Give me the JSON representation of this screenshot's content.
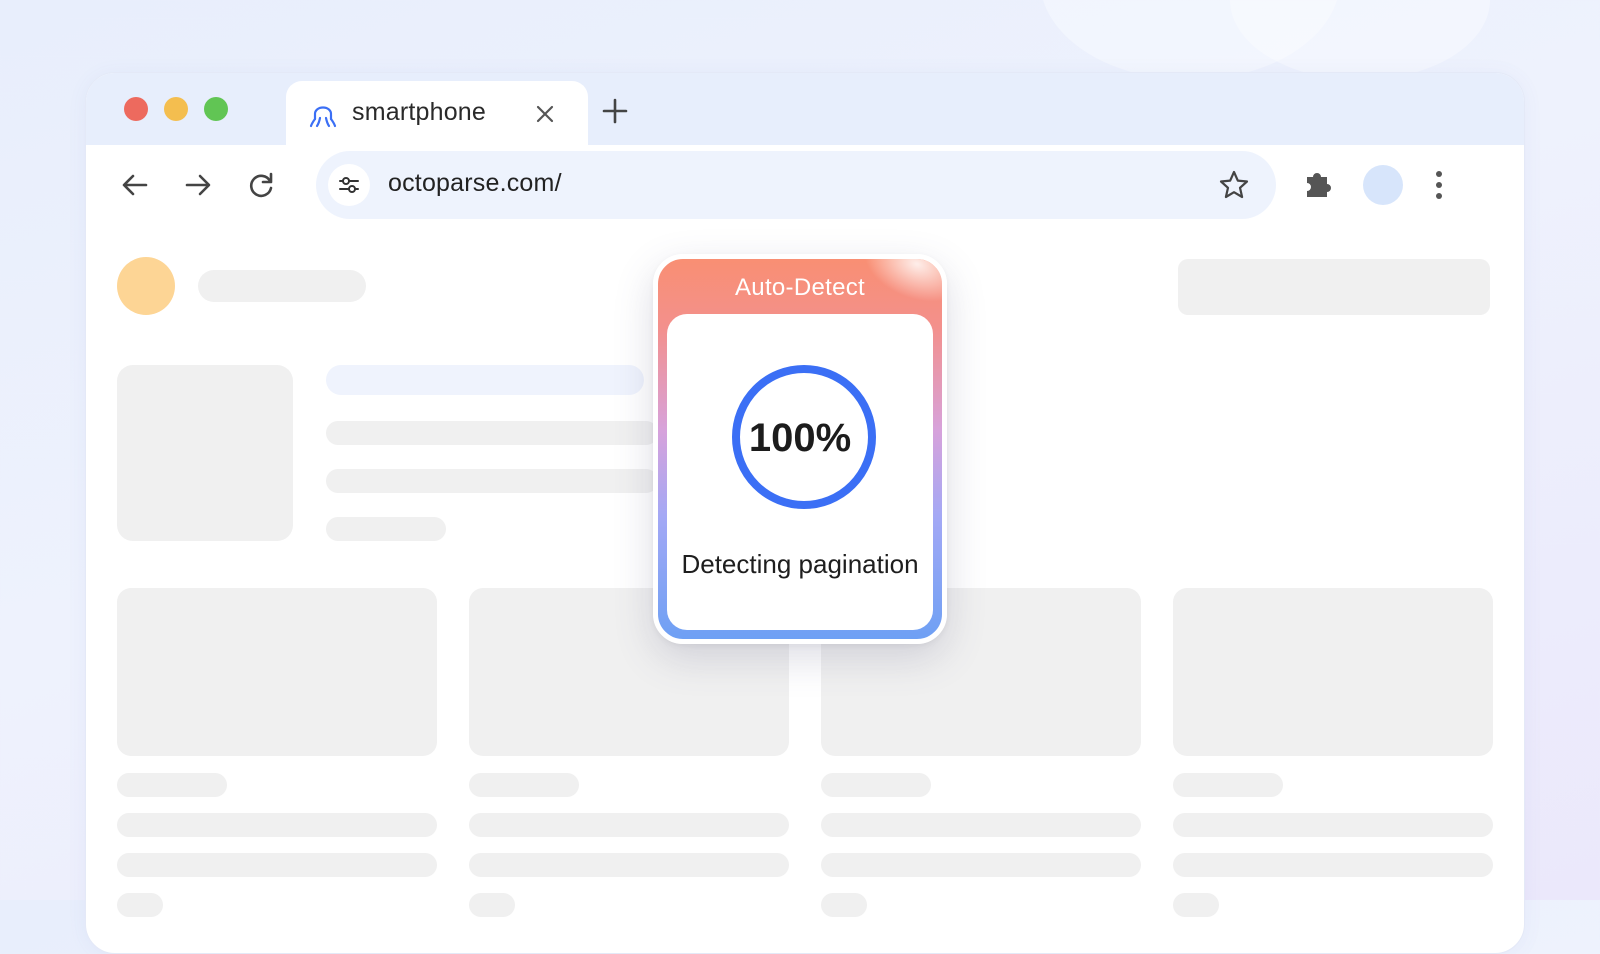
{
  "browser": {
    "tab": {
      "title": "smartphone",
      "icon": "octopus-icon"
    },
    "address_bar": {
      "url": "octoparse.com/"
    },
    "icons": {
      "back": "arrow-left-icon",
      "forward": "arrow-right-icon",
      "reload": "reload-icon",
      "site_settings": "tune-icon",
      "bookmark": "star-icon",
      "extensions": "puzzle-icon",
      "menu": "kebab-menu-icon"
    }
  },
  "popup": {
    "title": "Auto-Detect",
    "progress": {
      "value": 1.0,
      "label": "100%"
    },
    "status": "Detecting pagination"
  },
  "colors": {
    "traffic_red": "#ed6a5e",
    "traffic_yellow": "#f4be4f",
    "traffic_green": "#61c554",
    "progress_ring": "#3b6ff5",
    "accent_orange": "#f98f73",
    "avatar_placeholder": "#fdd595",
    "skeleton": "#f0f0f0"
  }
}
